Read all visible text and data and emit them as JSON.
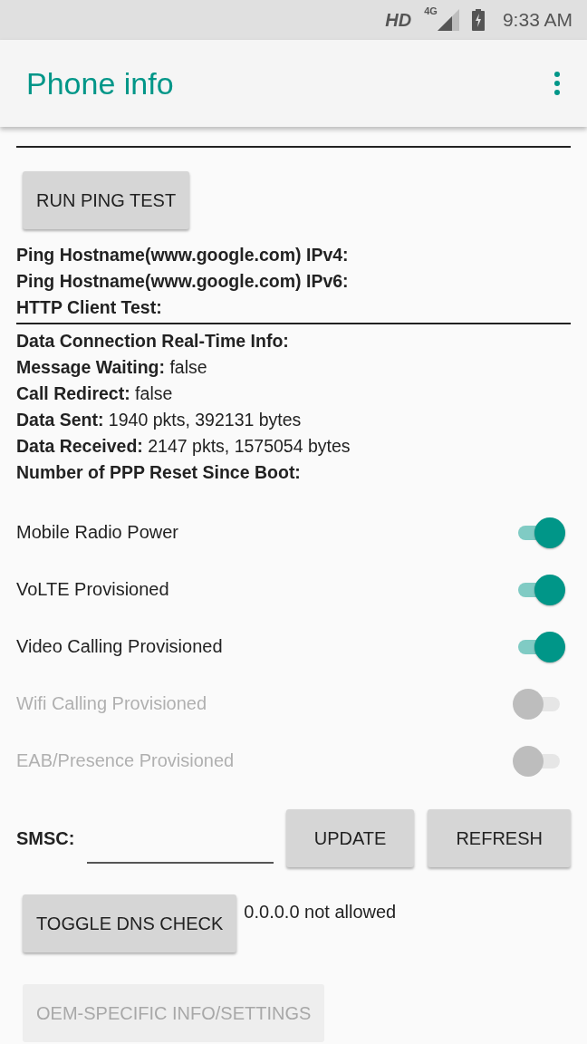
{
  "status_bar": {
    "network": "HD",
    "signal_type": "4G",
    "time": "9:33 AM"
  },
  "app_bar": {
    "title": "Phone info"
  },
  "ping_button": "RUN PING TEST",
  "ping_lines": [
    {
      "kind": "label",
      "text": "Ping Hostname(www.google.com) IPv4:"
    },
    {
      "kind": "label",
      "text": "Ping Hostname(www.google.com) IPv6:"
    },
    {
      "kind": "label",
      "text": "HTTP Client Test:"
    }
  ],
  "info_lines": [
    {
      "kind": "label",
      "text": "Data Connection Real-Time Info:"
    },
    {
      "kind": "field",
      "text": "**Message Waiting:** false"
    },
    {
      "kind": "field",
      "text": "**Call Redirect:** false"
    },
    {
      "kind": "field",
      "text": "**Data Sent:** 1940 pkts, 392131 bytes"
    },
    {
      "kind": "field",
      "text": "**Data Received:** 2147 pkts, 1575054 bytes"
    },
    {
      "kind": "label",
      "text": "Number of PPP Reset Since Boot:"
    }
  ],
  "switches": [
    {
      "label": "Mobile Radio Power",
      "on": true,
      "disabled": false
    },
    {
      "label": "VoLTE Provisioned",
      "on": true,
      "disabled": false
    },
    {
      "label": "Video Calling Provisioned",
      "on": true,
      "disabled": false
    },
    {
      "label": "Wifi Calling Provisioned",
      "on": false,
      "disabled": true
    },
    {
      "label": "EAB/Presence Provisioned",
      "on": false,
      "disabled": true
    }
  ],
  "smsc": {
    "label": "SMSC:",
    "buttons": [
      {
        "label": "UPDATE",
        "disabled": false
      },
      {
        "label": "REFRESH",
        "disabled": false
      }
    ]
  },
  "dns": {
    "button": "TOGGLE DNS CHECK",
    "status": "0.0.0.0 not allowed"
  },
  "oem_button": {
    "label": "OEM-SPECIFIC INFO/SETTINGS",
    "disabled": true
  }
}
